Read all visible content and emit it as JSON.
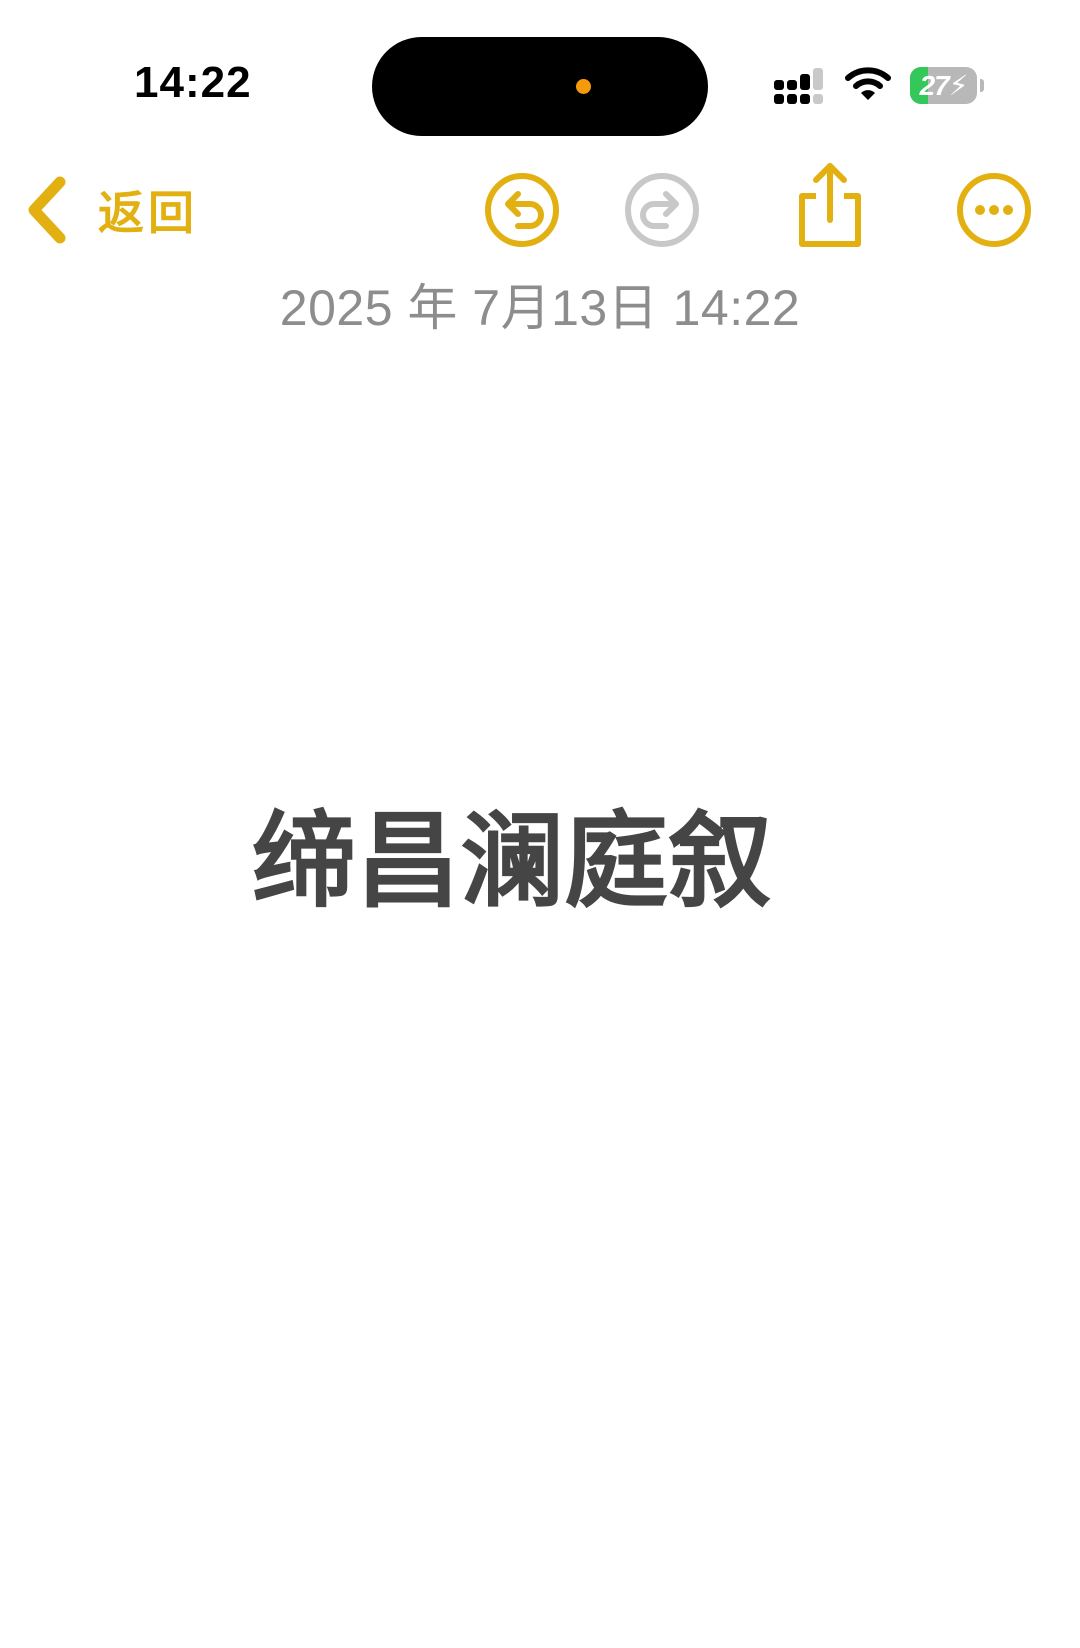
{
  "status_bar": {
    "time": "14:22",
    "battery_level": "27",
    "battery_percent": 27,
    "recording_indicator_color": "#f59a0a",
    "icons": [
      "cellular-signal-icon",
      "wifi-icon",
      "battery-charging-icon"
    ]
  },
  "toolbar": {
    "back_label": "返回",
    "accent_color": "#e2b011",
    "disabled_color": "#c8c8c8",
    "icons": [
      "back-chevron-icon",
      "undo-icon",
      "redo-icon",
      "share-icon",
      "more-icon"
    ]
  },
  "note": {
    "date": "2025 年 7月13日 14:22",
    "body": "缔昌澜庭叙"
  }
}
